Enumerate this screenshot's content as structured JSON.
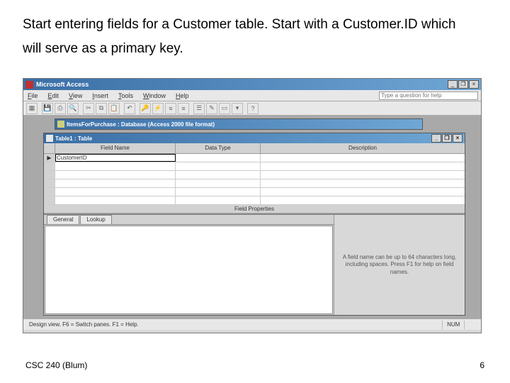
{
  "slide": {
    "title": "Start entering fields for a Customer table. Start with a Customer.ID which will serve as a primary key.",
    "footer_left": "CSC 240 (Blum)",
    "footer_right": "6"
  },
  "window": {
    "app_title": "Microsoft Access",
    "min": "_",
    "restore": "❐",
    "close": "×",
    "menu": {
      "file": "File",
      "edit": "Edit",
      "view": "View",
      "insert": "Insert",
      "tools": "Tools",
      "window": "Window",
      "help": "Help"
    },
    "help_placeholder": "Type a question for help"
  },
  "db_window": {
    "title": "ItemsForPurchase : Database (Access 2000 file format)"
  },
  "table_window": {
    "title": "Table1 : Table",
    "col_field_name": "Field Name",
    "col_data_type": "Data Type",
    "col_description": "Description",
    "row_marker": "▶",
    "field_name_value": "CustomerID"
  },
  "field_props": {
    "section_title": "Field Properties",
    "tab_general": "General",
    "tab_lookup": "Lookup",
    "help_text": "A field name can be up to 64 characters long, including spaces. Press F1 for help on field names."
  },
  "statusbar": {
    "main": "Design view.  F6 = Switch panes.  F1 = Help.",
    "num": "NUM"
  }
}
